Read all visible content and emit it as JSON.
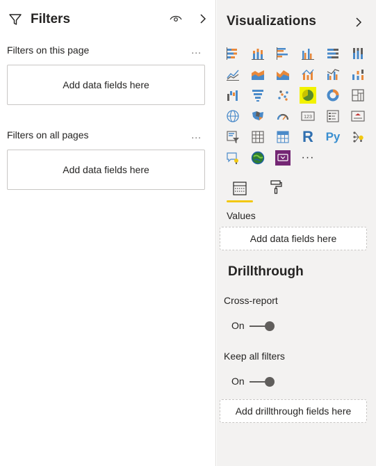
{
  "filters": {
    "title": "Filters",
    "sections": [
      {
        "label": "Filters on this page",
        "more": "...",
        "placeholder": "Add data fields here"
      },
      {
        "label": "Filters on all pages",
        "more": "...",
        "placeholder": "Add data fields here"
      }
    ]
  },
  "visualizations": {
    "title": "Visualizations",
    "icons": [
      "stacked-bar-chart-icon",
      "stacked-column-chart-icon",
      "clustered-bar-chart-icon",
      "clustered-column-chart-icon",
      "100-stacked-bar-chart-icon",
      "100-stacked-column-chart-icon",
      "line-chart-icon",
      "area-chart-icon",
      "stacked-area-chart-icon",
      "line-and-stacked-column-chart-icon",
      "line-and-clustered-column-chart-icon",
      "ribbon-chart-icon",
      "waterfall-chart-icon",
      "funnel-chart-icon",
      "scatter-chart-icon",
      "pie-chart-icon",
      "donut-chart-icon",
      "treemap-icon",
      "map-icon",
      "filled-map-icon",
      "gauge-icon",
      "card-icon",
      "multi-row-card-icon",
      "kpi-icon",
      "slicer-icon",
      "table-icon",
      "matrix-icon",
      "r-script-visual-icon",
      "python-visual-icon",
      "key-influencers-icon",
      "qa-visual-icon",
      "arcgis-map-icon",
      "power-apps-icon",
      "more-visuals-icon"
    ],
    "selected_icon": "pie-chart-icon",
    "r_label": "R",
    "py_label": "Py",
    "more_label": "···",
    "values_label": "Values",
    "values_placeholder": "Add data fields here",
    "drillthrough_heading": "Drillthrough",
    "cross_report_label": "Cross-report",
    "cross_report_state": "On",
    "keep_filters_label": "Keep all filters",
    "keep_filters_state": "On",
    "drillthrough_placeholder": "Add drillthrough fields here"
  },
  "colors": {
    "accent_yellow": "#f2c811",
    "selected_bg": "#f2f200",
    "blue": "#4a8ac9",
    "orange": "#e8883a",
    "gray": "#605e5c"
  }
}
